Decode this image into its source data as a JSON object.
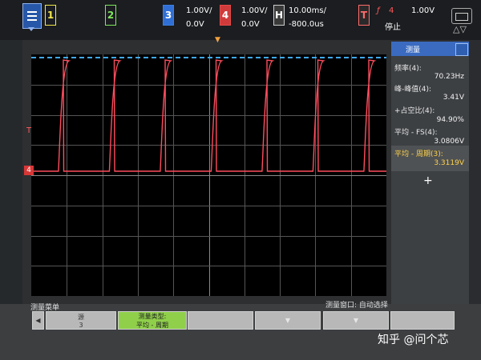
{
  "top_bar": {
    "channels": [
      {
        "num": "1"
      },
      {
        "num": "2"
      },
      {
        "num": "3",
        "scale": "1.00V/",
        "offset": "0.0V"
      },
      {
        "num": "4",
        "scale": "1.00V/",
        "offset": "0.0V"
      }
    ],
    "horizontal": {
      "badge": "H",
      "scale": "10.00ms/",
      "delay": "-800.0us"
    },
    "trigger": {
      "badge": "T",
      "glyph": "ƒ",
      "source": "4",
      "level": "1.00V",
      "state": "停止"
    }
  },
  "measurements": {
    "title": "测量",
    "items": [
      {
        "label": "频率(4):",
        "value": "70.23Hz"
      },
      {
        "label": "峰-峰值(4):",
        "value": "3.41V"
      },
      {
        "label": "+占空比(4):",
        "value": "94.90%"
      },
      {
        "label": "平均 - FS(4):",
        "value": "3.0806V"
      },
      {
        "label": "平均 - 周期(3):",
        "value": "3.3119V"
      }
    ],
    "add_symbol": "+"
  },
  "softkeys": {
    "menu_label": "测量菜单",
    "window_label": "测量窗口: 自动选择",
    "source_top": "源",
    "source_bottom": "3",
    "type_top": "测量类型:",
    "type_bottom": "平均 - 周期"
  },
  "watermark": "知乎 @问个芯",
  "colors": {
    "ch1": "#f2e84c",
    "ch2": "#7fe85c",
    "ch3": "#2f6fd6",
    "ch4": "#cf3b3b",
    "trace_ch4": "#ff4d5e",
    "trace_ch3": "#3fa9f5"
  }
}
